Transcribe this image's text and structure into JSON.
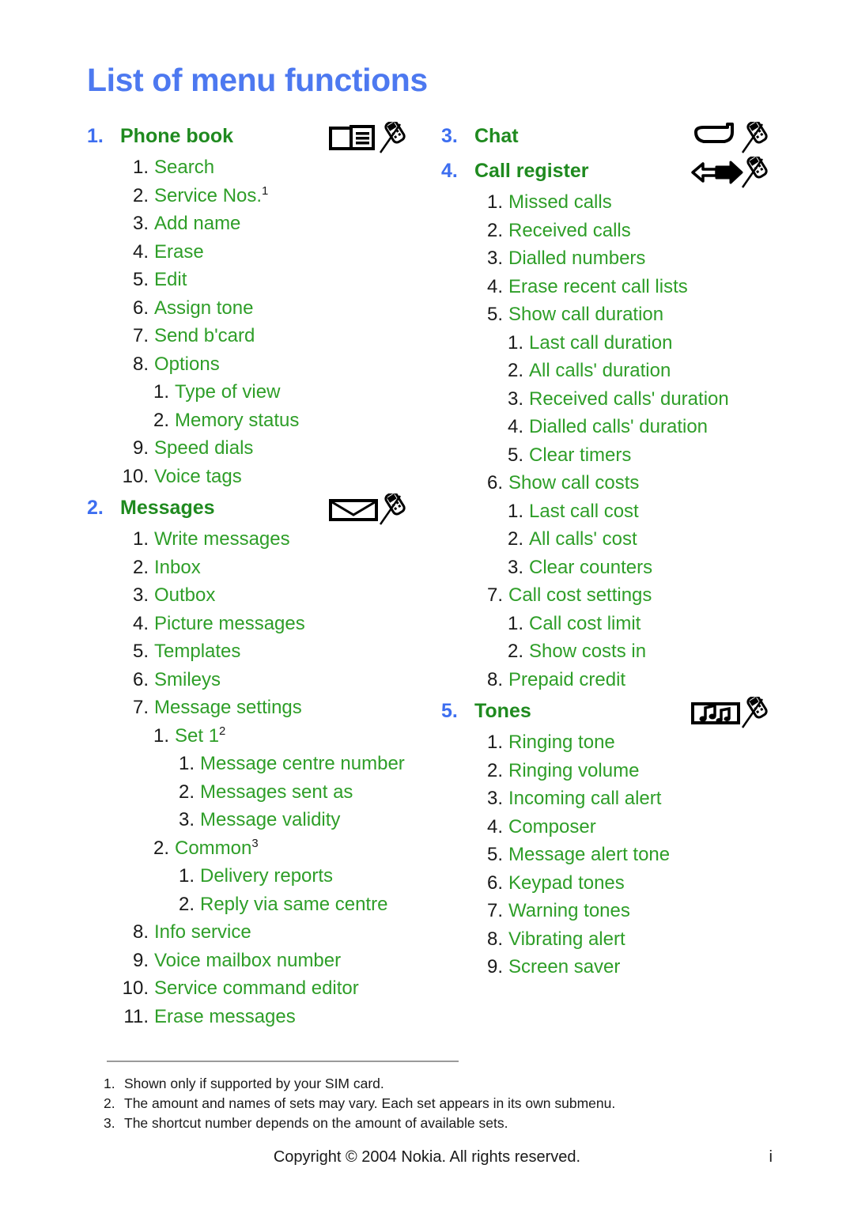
{
  "document": {
    "title": "List of menu functions"
  },
  "colors": {
    "title_blue": "#4d79f0",
    "section_number_blue": "#3d6ef0",
    "section_label_green": "#1f8a1f",
    "item_green": "#2e9e28",
    "item_number_black": "#1a1a1a",
    "rule_gray": "#9a9a9a"
  },
  "columns": {
    "left": [
      {
        "number": "1.",
        "label": "Phone book",
        "icon": "phone-book-icon",
        "items": [
          {
            "n": "1.",
            "text": "Search",
            "level": 1
          },
          {
            "n": "2.",
            "text": "Service Nos.",
            "sup": "1",
            "level": 1
          },
          {
            "n": "3.",
            "text": "Add name",
            "level": 1
          },
          {
            "n": "4.",
            "text": "Erase",
            "level": 1
          },
          {
            "n": "5.",
            "text": "Edit",
            "level": 1
          },
          {
            "n": "6.",
            "text": "Assign tone",
            "level": 1
          },
          {
            "n": "7.",
            "text": "Send b'card",
            "level": 1
          },
          {
            "n": "8.",
            "text": "Options",
            "level": 1
          },
          {
            "n": "1.",
            "text": "Type of view",
            "level": 2
          },
          {
            "n": "2.",
            "text": "Memory status",
            "level": 2
          },
          {
            "n": "9.",
            "text": "Speed dials",
            "level": 1
          },
          {
            "n": "10.",
            "text": "Voice tags",
            "level": 1
          }
        ]
      },
      {
        "number": "2.",
        "label": "Messages",
        "icon": "envelope-icon",
        "items": [
          {
            "n": "1.",
            "text": "Write messages",
            "level": 1
          },
          {
            "n": "2.",
            "text": "Inbox",
            "level": 1
          },
          {
            "n": "3.",
            "text": "Outbox",
            "level": 1
          },
          {
            "n": "4.",
            "text": "Picture messages",
            "level": 1
          },
          {
            "n": "5.",
            "text": "Templates",
            "level": 1
          },
          {
            "n": "6.",
            "text": "Smileys",
            "level": 1
          },
          {
            "n": "7.",
            "text": "Message settings",
            "level": 1
          },
          {
            "n": "1.",
            "text": "Set 1",
            "sup": "2",
            "level": 2
          },
          {
            "n": "1.",
            "text": "Message centre number",
            "level": 3
          },
          {
            "n": "2.",
            "text": "Messages sent as",
            "level": 3
          },
          {
            "n": "3.",
            "text": "Message validity",
            "level": 3
          },
          {
            "n": "2.",
            "text": "Common",
            "sup": "3",
            "level": 2
          },
          {
            "n": "1.",
            "text": "Delivery reports",
            "level": 3
          },
          {
            "n": "2.",
            "text": "Reply via same centre",
            "level": 3
          },
          {
            "n": "8.",
            "text": "Info service",
            "level": 1
          },
          {
            "n": "9.",
            "text": "Voice mailbox number",
            "level": 1
          },
          {
            "n": "10.",
            "text": "Service command editor",
            "level": 1
          },
          {
            "n": "11.",
            "text": "Erase messages",
            "level": 1
          }
        ]
      }
    ],
    "right": [
      {
        "number": "3.",
        "label": "Chat",
        "icon": "speech-bubble-icon",
        "items": []
      },
      {
        "number": "4.",
        "label": "Call register",
        "icon": "two-way-arrow-icon",
        "items": [
          {
            "n": "1.",
            "text": "Missed calls",
            "level": 1
          },
          {
            "n": "2.",
            "text": "Received calls",
            "level": 1
          },
          {
            "n": "3.",
            "text": "Dialled numbers",
            "level": 1
          },
          {
            "n": "4.",
            "text": "Erase recent call lists",
            "level": 1
          },
          {
            "n": "5.",
            "text": "Show call duration",
            "level": 1
          },
          {
            "n": "1.",
            "text": "Last call duration",
            "level": 2
          },
          {
            "n": "2.",
            "text": "All calls' duration",
            "level": 2
          },
          {
            "n": "3.",
            "text": "Received calls' duration",
            "level": 2
          },
          {
            "n": "4.",
            "text": "Dialled calls' duration",
            "level": 2
          },
          {
            "n": "5.",
            "text": "Clear timers",
            "level": 2
          },
          {
            "n": "6.",
            "text": "Show call costs",
            "level": 1
          },
          {
            "n": "1.",
            "text": "Last call cost",
            "level": 2
          },
          {
            "n": "2.",
            "text": "All calls' cost",
            "level": 2
          },
          {
            "n": "3.",
            "text": "Clear counters",
            "level": 2
          },
          {
            "n": "7.",
            "text": "Call cost settings",
            "level": 1
          },
          {
            "n": "1.",
            "text": "Call cost limit",
            "level": 2
          },
          {
            "n": "2.",
            "text": "Show costs in",
            "level": 2
          },
          {
            "n": "8.",
            "text": "Prepaid credit",
            "level": 1
          }
        ]
      },
      {
        "number": "5.",
        "label": "Tones",
        "icon": "music-note-icon",
        "items": [
          {
            "n": "1.",
            "text": "Ringing tone",
            "level": 1
          },
          {
            "n": "2.",
            "text": "Ringing volume",
            "level": 1
          },
          {
            "n": "3.",
            "text": "Incoming call alert",
            "level": 1
          },
          {
            "n": "4.",
            "text": "Composer",
            "level": 1
          },
          {
            "n": "5.",
            "text": "Message alert tone",
            "level": 1
          },
          {
            "n": "6.",
            "text": "Keypad tones",
            "level": 1
          },
          {
            "n": "7.",
            "text": "Warning tones",
            "level": 1
          },
          {
            "n": "8.",
            "text": "Vibrating alert",
            "level": 1
          },
          {
            "n": "9.",
            "text": "Screen saver",
            "level": 1
          }
        ]
      }
    ]
  },
  "footnotes": [
    {
      "n": "1.",
      "text": "Shown only if supported by your SIM card."
    },
    {
      "n": "2.",
      "text": "The amount and names of sets may vary. Each set appears in its own submenu."
    },
    {
      "n": "3.",
      "text": "The shortcut number depends on the amount of available sets."
    }
  ],
  "footer": {
    "copyright": "Copyright © 2004 Nokia. All rights reserved.",
    "page_number": "i"
  }
}
